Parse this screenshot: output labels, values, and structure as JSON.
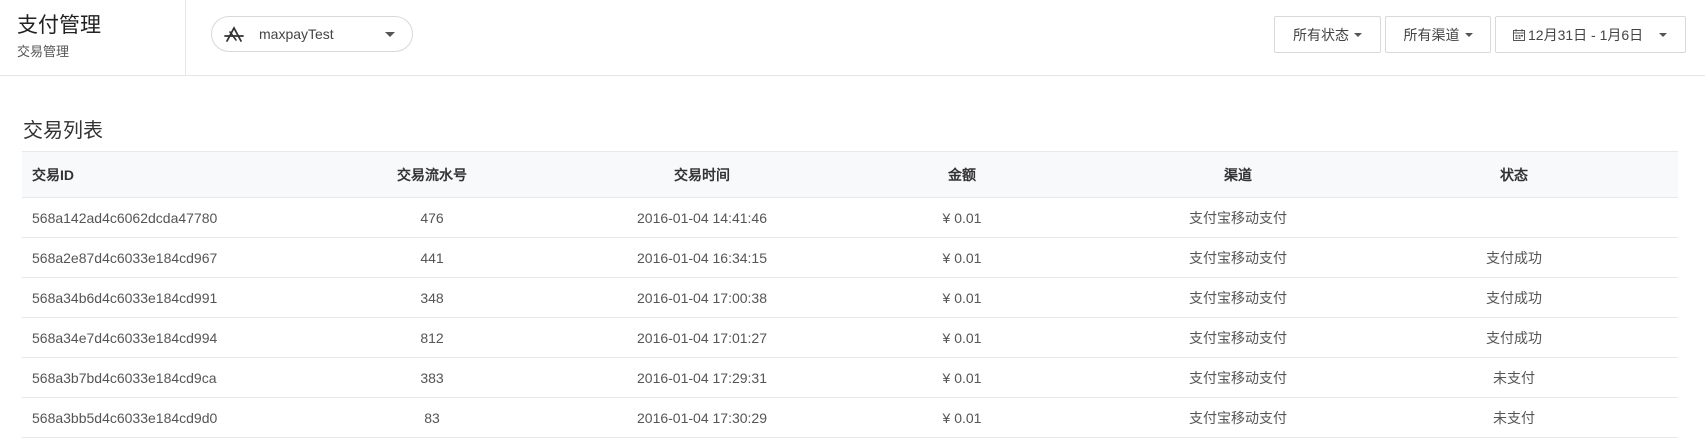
{
  "header": {
    "title": "支付管理",
    "subtitle": "交易管理",
    "app_name": "maxpayTest",
    "app_icon": "app-store-icon",
    "filters": {
      "status": "所有状态",
      "channel": "所有渠道",
      "date_range": "12月31日 - 1月6日"
    }
  },
  "section": {
    "title": "交易列表"
  },
  "table": {
    "columns": {
      "id": "交易ID",
      "serial": "交易流水号",
      "time": "交易时间",
      "amount": "金额",
      "channel": "渠道",
      "status": "状态"
    },
    "rows": [
      {
        "id": "568a142ad4c6062dcda47780",
        "serial": "476",
        "time": "2016-01-04 14:41:46",
        "amount": "¥ 0.01",
        "channel": "支付宝移动支付",
        "status": ""
      },
      {
        "id": "568a2e87d4c6033e184cd967",
        "serial": "441",
        "time": "2016-01-04 16:34:15",
        "amount": "¥ 0.01",
        "channel": "支付宝移动支付",
        "status": "支付成功"
      },
      {
        "id": "568a34b6d4c6033e184cd991",
        "serial": "348",
        "time": "2016-01-04 17:00:38",
        "amount": "¥ 0.01",
        "channel": "支付宝移动支付",
        "status": "支付成功"
      },
      {
        "id": "568a34e7d4c6033e184cd994",
        "serial": "812",
        "time": "2016-01-04 17:01:27",
        "amount": "¥ 0.01",
        "channel": "支付宝移动支付",
        "status": "支付成功"
      },
      {
        "id": "568a3b7bd4c6033e184cd9ca",
        "serial": "383",
        "time": "2016-01-04 17:29:31",
        "amount": "¥ 0.01",
        "channel": "支付宝移动支付",
        "status": "未支付"
      },
      {
        "id": "568a3bb5d4c6033e184cd9d0",
        "serial": "83",
        "time": "2016-01-04 17:30:29",
        "amount": "¥ 0.01",
        "channel": "支付宝移动支付",
        "status": "未支付"
      }
    ]
  }
}
